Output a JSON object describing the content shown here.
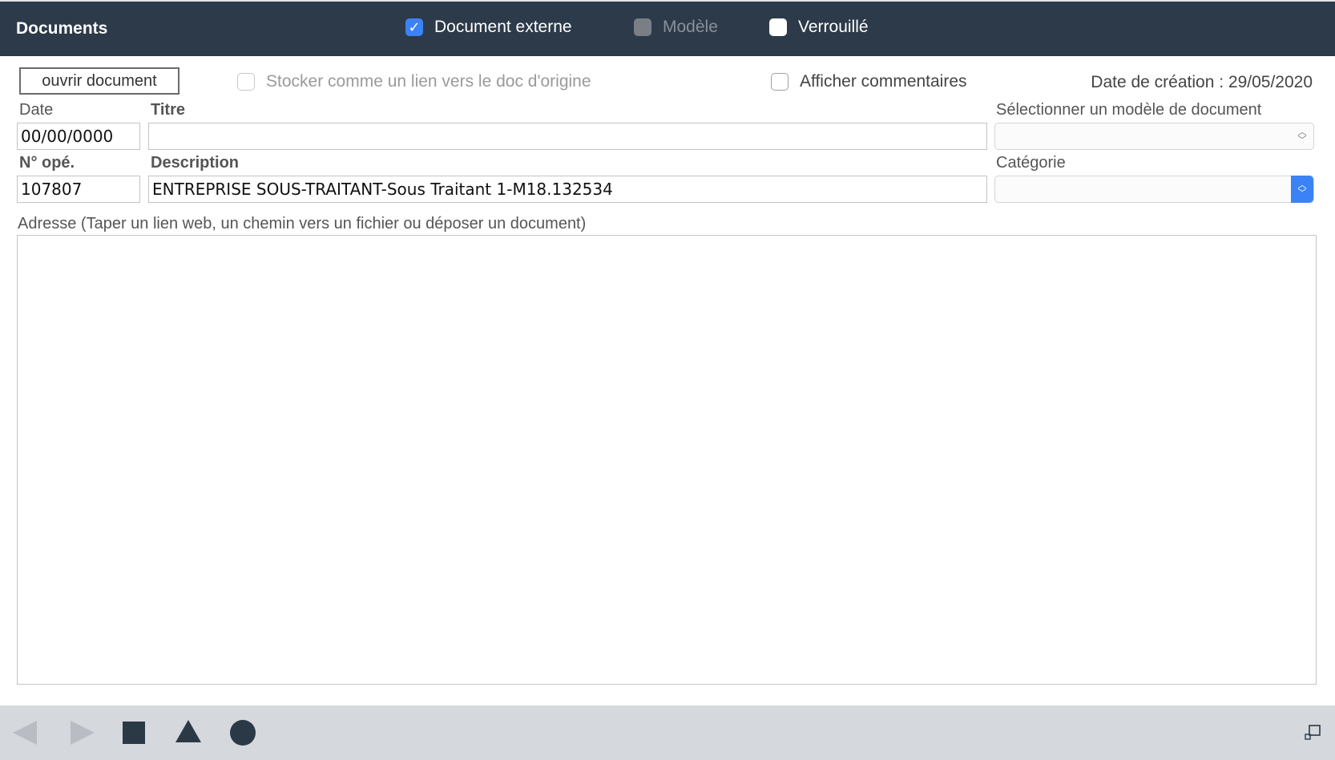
{
  "header": {
    "title": "Documents",
    "checkboxes": [
      {
        "label": "Document externe",
        "checked": true,
        "disabled": false
      },
      {
        "label": "Modèle",
        "checked": false,
        "disabled": true
      },
      {
        "label": "Verrouillé",
        "checked": false,
        "disabled": false
      }
    ]
  },
  "options": {
    "open_button": "ouvrir document",
    "store_link": "Stocker comme un lien vers le doc d'origine",
    "show_comments": "Afficher commentaires",
    "creation_date": "Date de création : 29/05/2020"
  },
  "form": {
    "date_label": "Date",
    "date_value": "00/00/0000",
    "title_label": "Titre",
    "title_value": "",
    "template_label": "Sélectionner un modèle de document",
    "template_value": "",
    "op_label": "N° opé.",
    "op_value": "107807",
    "description_label": "Description",
    "description_value": "ENTREPRISE SOUS-TRAITANT-Sous Traitant 1-M18.132534",
    "category_label": "Catégorie",
    "category_value": "",
    "address_label": "Adresse (Taper un lien web, un chemin vers un fichier ou déposer un document)",
    "address_value": ""
  },
  "footer": {
    "icons": [
      "previous-arrow-icon",
      "next-arrow-icon",
      "square-icon",
      "triangle-icon",
      "circle-icon",
      "resize-icon"
    ]
  },
  "colors": {
    "header_bg": "#2d3a4a",
    "accent": "#3b82f6",
    "footer_bg": "#d5d8dd",
    "shape_dark": "#2b3947"
  }
}
